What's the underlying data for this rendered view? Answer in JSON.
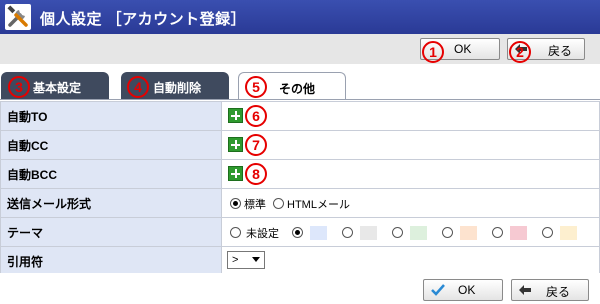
{
  "header": {
    "title": "個人設定 ［アカウント登録］",
    "icon": "tools-icon"
  },
  "toolbar": {
    "ok_label": "OK",
    "back_label": "戻る",
    "ok_marker": "1",
    "back_marker": "2"
  },
  "tabs": [
    {
      "label": "基本設定",
      "marker": "3"
    },
    {
      "label": "自動削除",
      "marker": "4"
    },
    {
      "label": "その他",
      "marker": "5"
    }
  ],
  "rows": {
    "auto_to": {
      "label": "自動TO",
      "marker": "6"
    },
    "auto_cc": {
      "label": "自動CC",
      "marker": "7"
    },
    "auto_bcc": {
      "label": "自動BCC",
      "marker": "8"
    },
    "mail_format": {
      "label": "送信メール形式",
      "options": [
        "標準",
        "HTMLメール"
      ],
      "selected": "標準"
    },
    "theme": {
      "label": "テーマ",
      "unset_label": "未設定",
      "swatch_colors": [
        "#dde7fb",
        "#e8e8e8",
        "#ddf0dd",
        "#fde3cf",
        "#f6c9d2",
        "#fdefcf"
      ]
    },
    "quote": {
      "label": "引用符",
      "value": ">"
    }
  },
  "footer": {
    "ok_label": "OK",
    "back_label": "戻る"
  },
  "colors": {
    "titlebar": "#2f3f9e",
    "tab_dark": "#3f4a5e",
    "label_bg": "#dfe6f5",
    "marker_red": "#e60000",
    "plus_green": "#2e9a2e"
  }
}
